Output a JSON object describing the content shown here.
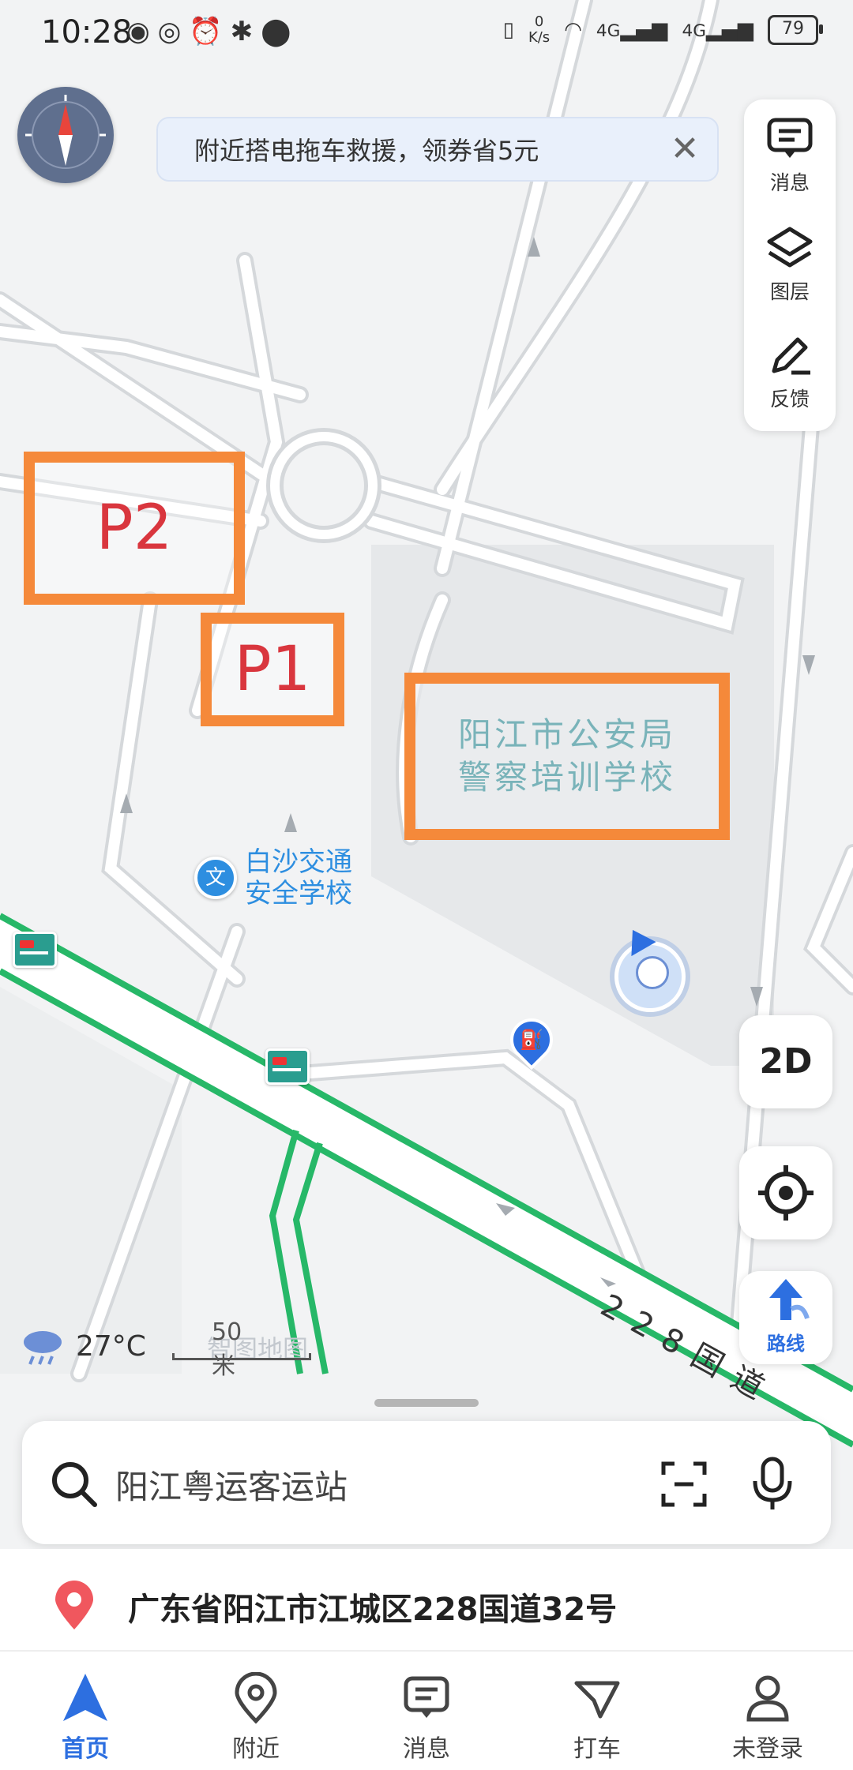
{
  "status_bar": {
    "time": "10:28",
    "speed_value": "0",
    "speed_unit": "K/s",
    "battery": "79",
    "network_1": "4G",
    "network_2": "4G"
  },
  "banner": {
    "text": "附近搭电拖车救援，领券省5元",
    "close_icon": "close-icon"
  },
  "tools": [
    {
      "label": "消息",
      "icon": "message-icon"
    },
    {
      "label": "图层",
      "icon": "layers-icon"
    },
    {
      "label": "反馈",
      "icon": "feedback-pen-icon"
    }
  ],
  "map": {
    "box_p1": "P1",
    "box_p2": "P2",
    "school_label_line1": "阳江市公安局",
    "school_label_line2": "警察培训学校",
    "poi_badge": "文",
    "poi_name_line1": "白沙交通",
    "poi_name_line2": "安全学校",
    "road_label": "228国道",
    "colors": {
      "road_green": "#27b868",
      "box_orange": "#f5893a",
      "box_text": "#d9363e",
      "accent": "#2d6fe0"
    }
  },
  "controls": {
    "view_mode": "2D",
    "route_label": "路线"
  },
  "weather": {
    "temperature": "27°C",
    "icon": "rain-cloud-icon"
  },
  "scale": {
    "label": "50米",
    "brand": "智图地图"
  },
  "search": {
    "placeholder": "阳江粤运客运站"
  },
  "address": {
    "text": "广东省阳江市江城区228国道32号"
  },
  "bottom_nav": [
    {
      "label": "首页",
      "icon": "navigation-arrow-icon",
      "active": true
    },
    {
      "label": "附近",
      "icon": "location-pin-icon",
      "active": false
    },
    {
      "label": "消息",
      "icon": "message-icon",
      "active": false
    },
    {
      "label": "打车",
      "icon": "taxi-icon",
      "active": false
    },
    {
      "label": "未登录",
      "icon": "user-icon",
      "active": false
    }
  ]
}
